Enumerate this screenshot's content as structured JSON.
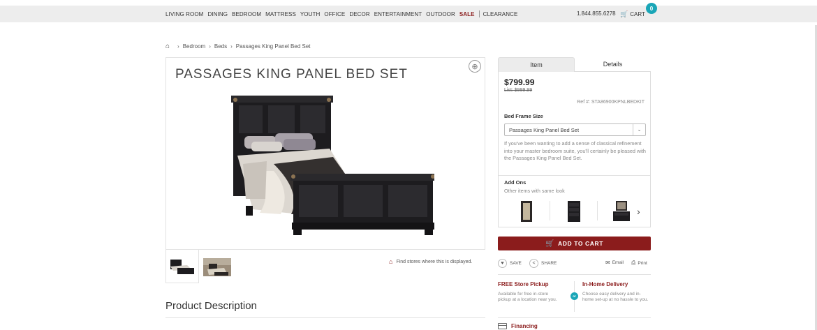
{
  "nav": {
    "items": [
      "LIVING ROOM",
      "DINING",
      "BEDROOM",
      "MATTRESS",
      "YOUTH",
      "OFFICE",
      "DECOR",
      "ENTERTAINMENT",
      "OUTDOOR"
    ],
    "sale": "SALE",
    "clearance": "CLEARANCE",
    "phone": "1.844.855.6278",
    "cart_label": "CART",
    "cart_count": "0"
  },
  "breadcrumb": {
    "home_icon": "home-icon",
    "items": [
      "Bedroom",
      "Beds",
      "Passages King Panel Bed Set"
    ]
  },
  "product": {
    "title": "PASSAGES KING PANEL BED SET",
    "zoom_icon": "zoom-in-icon",
    "thumbnails": [
      "bed-thumbnail",
      "bedroom-scene-thumbnail"
    ],
    "find_stores": "Find stores where this is displayed."
  },
  "description": {
    "heading": "Product Description"
  },
  "tabs": {
    "item": "Item",
    "details": "Details"
  },
  "pricing": {
    "price": "$799.99",
    "list_price": "List: $999.99",
    "ref": "Ref #: STA86900KPNLBEDKIT"
  },
  "options": {
    "size_label": "Bed Frame Size",
    "selected": "Passages King Panel Bed Set",
    "blurb": "If you've been wanting to add a sense of classical refinement into your master bedroom suite, you'll certainly be pleased with the Passages King Panel Bed Set."
  },
  "addons": {
    "label": "Add Ons",
    "sub": "Other items with same look",
    "items": [
      "mirror-thumbnail",
      "chest-thumbnail",
      "dresser-thumbnail"
    ]
  },
  "actions": {
    "add_to_cart": "ADD TO CART",
    "save": "SAVE",
    "share": "SHARE",
    "email": "Email",
    "print": "Print"
  },
  "delivery": {
    "pickup_title": "FREE Store Pickup",
    "pickup_text": "Available for free in-store pickup at a location near you.",
    "or": "or",
    "home_title": "In-Home Delivery",
    "home_text": "Choose easy delivery and in-home set-up at no hassle to you.",
    "financing": "Financing"
  },
  "colors": {
    "accent_red": "#8b1c1c",
    "teal": "#1aa6b7"
  }
}
